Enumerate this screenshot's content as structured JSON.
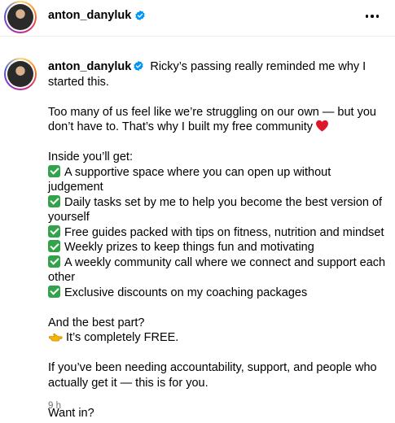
{
  "header": {
    "username": "anton_danyluk",
    "verified": true,
    "more_icon": "more-horizontal-icon"
  },
  "post": {
    "username": "anton_danyluk",
    "verified": true,
    "intro": "Ricky’s passing really reminded me why I started this.",
    "paragraph": "Too many of us feel like we’re struggling on our own — but you don’t have to. That’s why I built my free community",
    "heart_icon": "red-heart-icon",
    "inside_heading": "Inside you’ll get:",
    "benefits": [
      "A supportive space where you can open up without judgement",
      "Daily tasks set by me to help you become the best version of yourself",
      "Free guides packed with tips on fitness, nutrition and mindset",
      "Weekly prizes to keep things fun and motivating",
      "A weekly community call where we connect and support each other",
      "Exclusive discounts on my coaching packages"
    ],
    "best_part": "And the best part?",
    "free_line": "It’s completely FREE.",
    "accountability": "If you’ve been needing accountability, support, and people who actually get it — this is for you.",
    "want_in": "Want in?",
    "timestamp": "9 h"
  },
  "colors": {
    "verified_blue": "#0095f6",
    "check_green": "#33a34b",
    "heart_red": "#e0162b",
    "muted": "#737373"
  }
}
